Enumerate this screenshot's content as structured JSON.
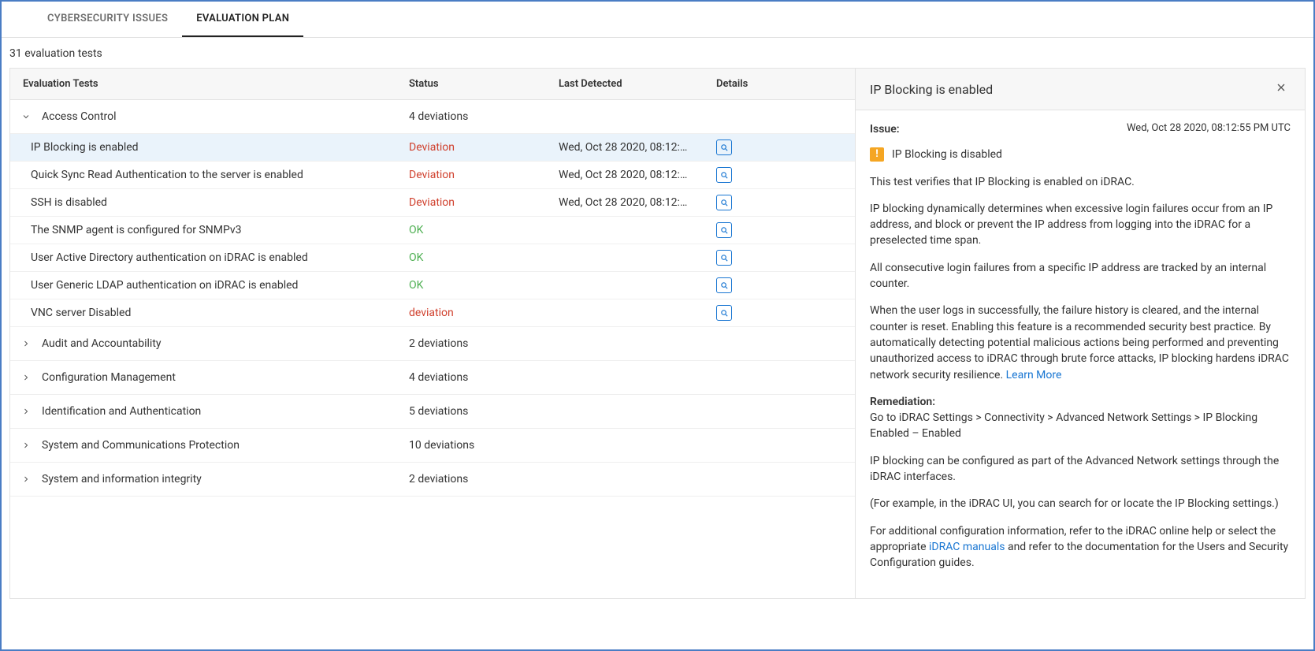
{
  "tabs": {
    "issues": "CYBERSECURITY ISSUES",
    "plan": "EVALUATION PLAN"
  },
  "count_line": "31 evaluation tests",
  "headers": {
    "tests": "Evaluation Tests",
    "status": "Status",
    "last": "Last Detected",
    "details": "Details"
  },
  "groups": [
    {
      "name": "Access Control",
      "summary": "4 deviations",
      "expanded": true,
      "tests": [
        {
          "name": "IP Blocking is enabled",
          "status": "Deviation",
          "status_class": "dev",
          "last": "Wed, Oct 28 2020, 08:12:55 PM ...",
          "selected": true
        },
        {
          "name": "Quick Sync Read Authentication to the server is enabled",
          "status": "Deviation",
          "status_class": "dev",
          "last": "Wed, Oct 28 2020, 08:12:55 PM ..."
        },
        {
          "name": "SSH is disabled",
          "status": "Deviation",
          "status_class": "dev",
          "last": "Wed, Oct 28 2020, 08:12:55 PM ..."
        },
        {
          "name": "The SNMP agent is configured for SNMPv3",
          "status": "OK",
          "status_class": "ok",
          "last": ""
        },
        {
          "name": "User Active Directory authentication on iDRAC is enabled",
          "status": "OK",
          "status_class": "ok",
          "last": ""
        },
        {
          "name": "User Generic LDAP authentication on iDRAC is enabled",
          "status": "OK",
          "status_class": "ok",
          "last": ""
        },
        {
          "name": "VNC server Disabled",
          "status": "deviation",
          "status_class": "dev",
          "last": ""
        }
      ]
    },
    {
      "name": "Audit and Accountability",
      "summary": "2 deviations",
      "expanded": false,
      "tests": []
    },
    {
      "name": "Configuration Management",
      "summary": "4 deviations",
      "expanded": false,
      "tests": []
    },
    {
      "name": "Identification and Authentication",
      "summary": "5 deviations",
      "expanded": false,
      "tests": []
    },
    {
      "name": "System and Communications Protection",
      "summary": "10 deviations",
      "expanded": false,
      "tests": []
    },
    {
      "name": "System and information integrity",
      "summary": "2 deviations",
      "expanded": false,
      "tests": []
    }
  ],
  "detail": {
    "title": "IP Blocking is enabled",
    "issue_label": "Issue:",
    "issue_time": "Wed, Oct 28 2020, 08:12:55 PM UTC",
    "warn_text": "IP Blocking is disabled",
    "para1": "This test verifies that IP Blocking is enabled on iDRAC.",
    "para2": "IP blocking dynamically determines when excessive login failures occur from an IP address, and block or prevent the IP address from logging into the iDRAC for a preselected time span.",
    "para3": "All consecutive login failures from a specific IP address are tracked by an internal counter.",
    "para4_a": "When the user logs in successfully, the failure history is cleared, and the internal counter is reset. Enabling this feature is a recommended security best practice. By automatically detecting potential malicious actions being performed and preventing unauthorized access to iDRAC through brute force attacks, IP blocking hardens iDRAC network security resilience. ",
    "learn_more": "Learn More",
    "remediation_label": "Remediation:",
    "remediation_path": "Go to iDRAC Settings > Connectivity > Advanced Network Settings > IP Blocking Enabled – Enabled",
    "para5": "IP blocking can be configured as part of the Advanced Network settings through the iDRAC interfaces.",
    "para6": "(For example, in the iDRAC UI, you can search for or locate the IP Blocking settings.)",
    "para7_a": "For additional configuration information, refer to the iDRAC online help or select the appropriate ",
    "idrac_manuals": "iDRAC manuals",
    "para7_b": " and refer to the documentation for the Users and Security Configuration guides."
  }
}
